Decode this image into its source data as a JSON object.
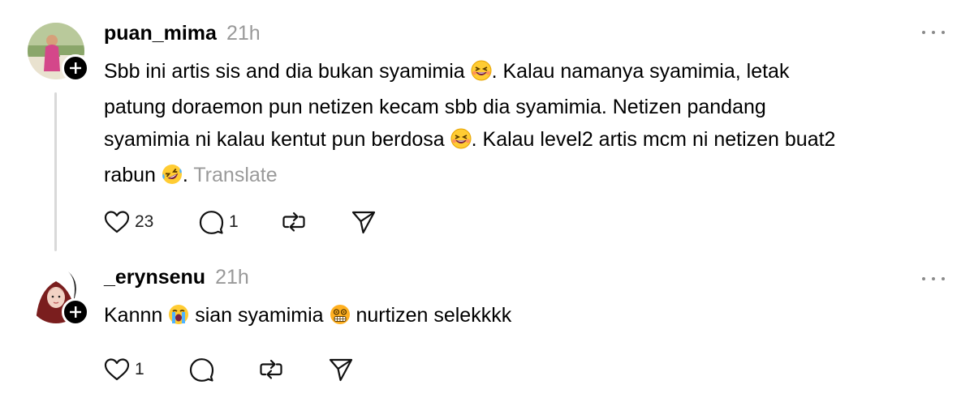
{
  "posts": [
    {
      "username": "puan_mima",
      "time": "21h",
      "lines": [
        [
          "Sbb ini artis sis and dia bukan syamimia ",
          "grin-squint",
          ". Kalau namanya syamimia, letak"
        ],
        [
          "patung doraemon pun netizen kecam sbb dia syamimia. Netizen pandang"
        ],
        [
          "syamimia ni kalau kentut pun berdosa ",
          "grin-squint",
          ". Kalau level2 artis mcm ni netizen buat2"
        ],
        [
          "rabun ",
          "rofl",
          ".  "
        ]
      ],
      "translate": "Translate",
      "likes": "23",
      "replies": "1"
    },
    {
      "username": "_erynsenu",
      "time": "21h",
      "text_parts": [
        "Kannn ",
        "loudly-crying",
        " sian syamimia ",
        "grimace-dizzy",
        " nurtizen selekkkk"
      ],
      "likes": "1",
      "replies": ""
    }
  ],
  "icons": {
    "like": "heart-icon",
    "reply": "comment-icon",
    "repost": "repost-icon",
    "share": "send-icon",
    "more": "more-icon",
    "follow": "plus-icon"
  }
}
